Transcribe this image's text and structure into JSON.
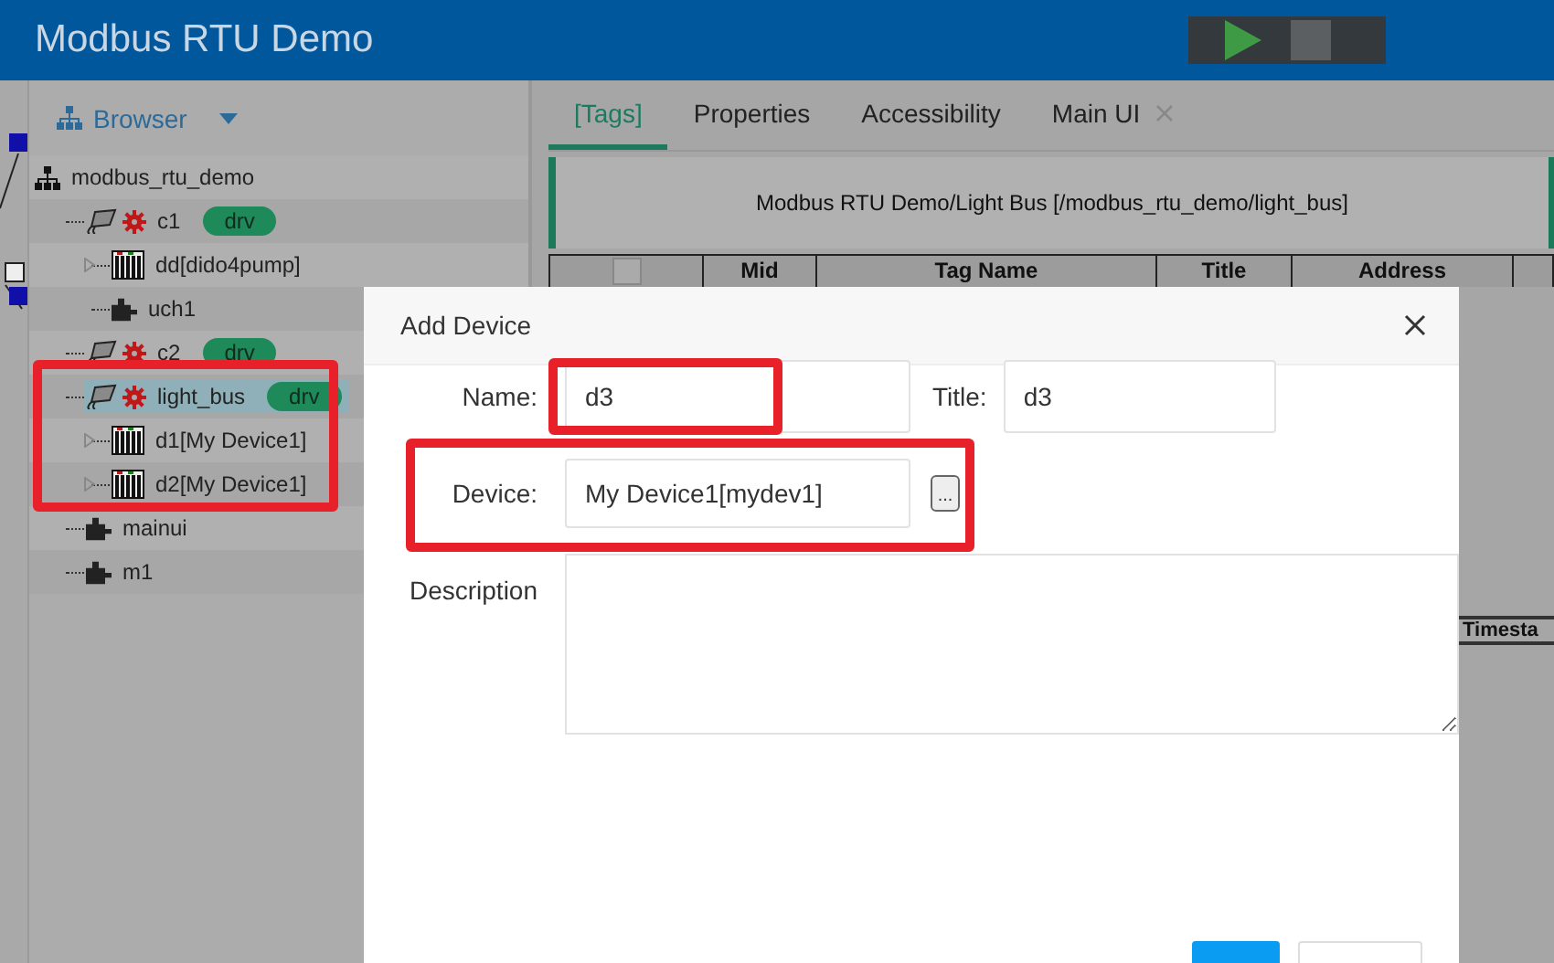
{
  "header": {
    "title": "Modbus RTU Demo"
  },
  "sidebar": {
    "title": "Browser",
    "tree": [
      {
        "label": "modbus_rtu_demo",
        "kind": "project",
        "selected": false,
        "highlighted": false,
        "children": [
          {
            "label": "c1",
            "kind": "channel",
            "badge": "drv",
            "selected": false,
            "highlighted": false,
            "children": [
              {
                "label": "dd[dido4pump]",
                "kind": "device",
                "selected": false,
                "highlighted": false
              },
              {
                "label": "uch1",
                "kind": "component",
                "selected": false,
                "highlighted": false
              }
            ]
          },
          {
            "label": "c2",
            "kind": "channel",
            "badge": "drv",
            "selected": false,
            "highlighted": false
          },
          {
            "label": "light_bus",
            "kind": "channel",
            "badge": "drv",
            "selected": true,
            "highlighted": true,
            "children": [
              {
                "label": "d1[My Device1]",
                "kind": "device",
                "selected": false,
                "highlighted": false
              },
              {
                "label": "d2[My Device1]",
                "kind": "device",
                "selected": false,
                "highlighted": false
              }
            ]
          },
          {
            "label": "mainui",
            "kind": "component",
            "selected": false,
            "highlighted": false
          },
          {
            "label": "m1",
            "kind": "component",
            "selected": false,
            "highlighted": false
          }
        ]
      }
    ]
  },
  "tabs": [
    {
      "label": "[Tags]",
      "selected": true,
      "closable": false
    },
    {
      "label": "Properties",
      "selected": false,
      "closable": false
    },
    {
      "label": "Accessibility",
      "selected": false,
      "closable": false
    },
    {
      "label": "Main UI",
      "selected": false,
      "closable": true
    }
  ],
  "path_panel": {
    "text": "Modbus RTU Demo/Light Bus [/modbus_rtu_demo/light_bus]"
  },
  "table": {
    "select_all_checked": false,
    "columns": [
      "Mid",
      "Tag Name",
      "Title",
      "Address"
    ]
  },
  "lower_table": {
    "columns": [
      "Timesta"
    ]
  },
  "dialog": {
    "title": "Add Device",
    "fields": [
      {
        "label": "Name:",
        "value": "d3",
        "highlighted": true
      },
      {
        "label": "Title:",
        "value": "d3",
        "highlighted": false
      },
      {
        "label": "Device:",
        "value": "My Device1[mydev1]",
        "highlighted": true,
        "browse_button": "..."
      },
      {
        "label": "Description"
      }
    ],
    "footer_buttons": [
      {
        "kind": "primary"
      },
      {
        "kind": "default"
      }
    ]
  }
}
